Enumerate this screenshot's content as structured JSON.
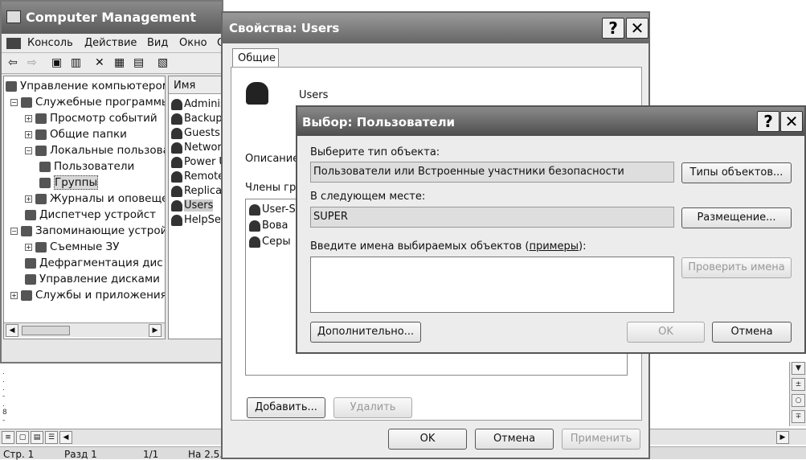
{
  "word": {
    "ruler_marks": [
      ".",
      ".",
      ".",
      "-",
      ".",
      "8",
      "-"
    ],
    "scroll_buttons": [
      "▼",
      "±",
      "○",
      "∓"
    ],
    "view_buttons": [
      "≡",
      "▢",
      "▤",
      "☰",
      "◀"
    ],
    "right_arrow": "▶",
    "status": {
      "page": "Стр. 1",
      "section": "Разд 1",
      "pages": "1/1",
      "pos": "На 2.5..."
    }
  },
  "cm": {
    "title": "Computer Management",
    "menu": [
      "Консоль",
      "Действие",
      "Вид",
      "Окно",
      "С"
    ],
    "toolbar": [
      "⇦",
      "⇨",
      "▣",
      "▥",
      "✕",
      "▦",
      "▤",
      "▧"
    ],
    "tree": [
      {
        "label": "Управление компьютером",
        "exp": "",
        "level": 0
      },
      {
        "label": "Служебные программы",
        "exp": "−",
        "level": 1
      },
      {
        "label": "Просмотр событий",
        "exp": "+",
        "level": 2
      },
      {
        "label": "Общие папки",
        "exp": "+",
        "level": 2
      },
      {
        "label": "Локальные пользова",
        "exp": "−",
        "level": 2
      },
      {
        "label": "Пользователи",
        "exp": "",
        "level": 3
      },
      {
        "label": "Группы",
        "exp": "",
        "level": 3
      },
      {
        "label": "Журналы и оповещен",
        "exp": "+",
        "level": 2
      },
      {
        "label": "Диспетчер устройст",
        "exp": "",
        "level": 2
      },
      {
        "label": "Запоминающие устройс",
        "exp": "−",
        "level": 1
      },
      {
        "label": "Съемные ЗУ",
        "exp": "+",
        "level": 2
      },
      {
        "label": "Дефрагментация дис",
        "exp": "",
        "level": 2
      },
      {
        "label": "Управление дисками",
        "exp": "",
        "level": 2
      },
      {
        "label": "Службы и приложения",
        "exp": "+",
        "level": 1
      }
    ],
    "list_header": "Имя",
    "list": [
      "Adminis",
      "Backup",
      "Guests",
      "Network",
      "Power U",
      "Remote",
      "Replicat",
      "Users",
      "HelpSer"
    ],
    "scroll_left": "◀",
    "scroll_right": "▶"
  },
  "props": {
    "title": "Свойства: Users",
    "help": "?",
    "close": "✕",
    "tab": "Общие",
    "group_name": "Users",
    "description_label": "Описание",
    "members_label": "Члены гру",
    "members": [
      "User-S",
      "Вова",
      "Серы"
    ],
    "add": "Добавить...",
    "remove": "Удалить",
    "ok": "OK",
    "cancel": "Отмена",
    "apply": "Применить"
  },
  "select": {
    "title": "Выбор: Пользователи",
    "help": "?",
    "close": "✕",
    "type_label": "Выберите тип объекта:",
    "type_value": "Пользователи или Встроенные участники безопасности",
    "types_btn": "Типы объектов...",
    "location_label": "В следующем месте:",
    "location_value": "SUPER",
    "location_btn": "Размещение...",
    "names_label_a": "Введите имена выбираемых объектов (",
    "names_link": "примеры",
    "names_label_b": "):",
    "names_value": "",
    "check_btn": "Проверить имена",
    "advanced_btn": "Дополнительно...",
    "ok": "OK",
    "cancel": "Отмена"
  }
}
